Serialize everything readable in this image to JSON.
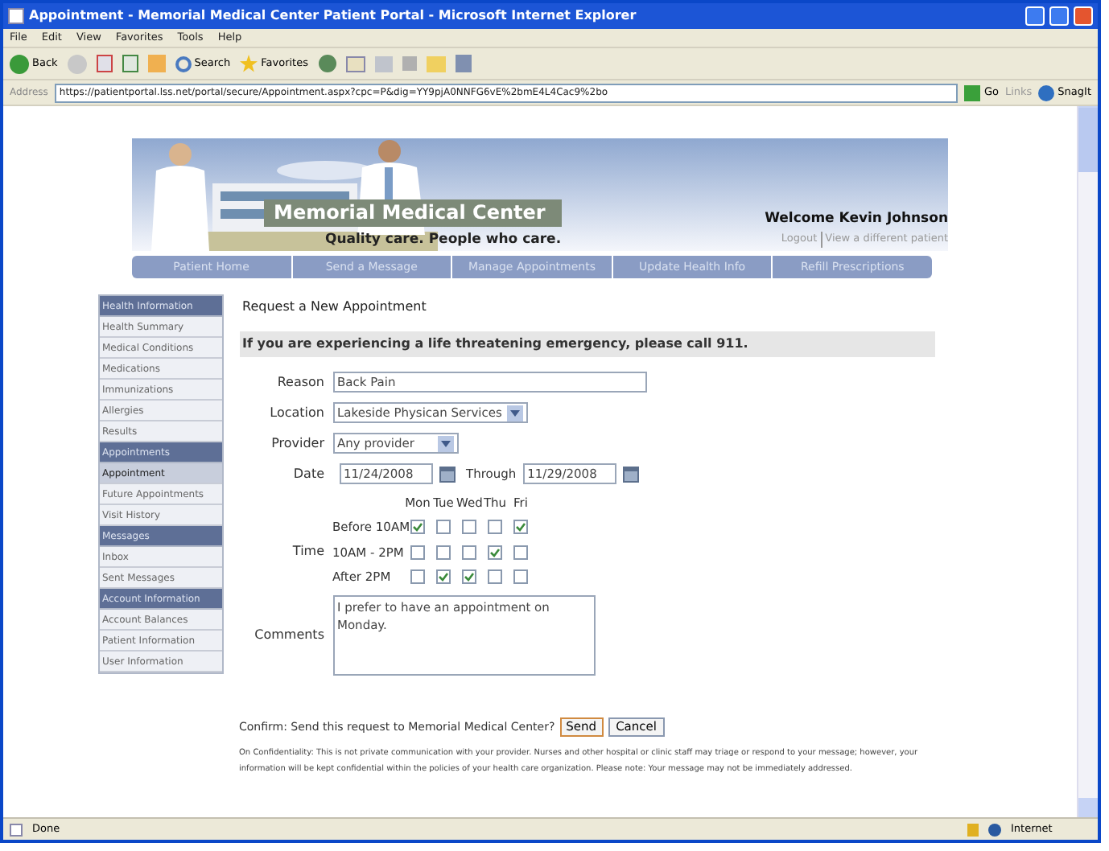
{
  "window": {
    "title": "Appointment - Memorial Medical Center Patient Portal - Microsoft Internet Explorer"
  },
  "menu": [
    "File",
    "Edit",
    "View",
    "Favorites",
    "Tools",
    "Help"
  ],
  "toolbar": {
    "back": "Back",
    "search": "Search",
    "favorites": "Favorites"
  },
  "address_bar": {
    "label": "Address",
    "url": "https://patientportal.lss.net/portal/secure/Appointment.aspx?cpc=P&dig=YY9pjA0NNFG6vE%2bmE4L4Cac9%2bo",
    "go": "Go",
    "links": "Links",
    "snagit": "SnagIt"
  },
  "banner": {
    "title": "Memorial Medical Center",
    "tagline": "Quality care. People who care.",
    "welcome": "Welcome Kevin Johnson",
    "logout": "Logout",
    "switch_patient": "View a different patient"
  },
  "nav": [
    "Patient Home",
    "Send a Message",
    "Manage Appointments",
    "Update Health Info",
    "Refill Prescriptions"
  ],
  "sidebar": [
    {
      "title": "Health Information",
      "items": [
        {
          "label": "Health Summary",
          "selected": false
        },
        {
          "label": "Medical Conditions",
          "selected": false
        },
        {
          "label": "Medications",
          "selected": false
        },
        {
          "label": "Immunizations",
          "selected": false
        },
        {
          "label": "Allergies",
          "selected": false
        },
        {
          "label": "Results",
          "selected": false
        }
      ]
    },
    {
      "title": "Appointments",
      "items": [
        {
          "label": "Appointment",
          "selected": true
        },
        {
          "label": "Future Appointments",
          "selected": false
        },
        {
          "label": "Visit History",
          "selected": false
        }
      ]
    },
    {
      "title": "Messages",
      "items": [
        {
          "label": "Inbox",
          "selected": false
        },
        {
          "label": "Sent Messages",
          "selected": false
        }
      ]
    },
    {
      "title": "Account Information",
      "items": [
        {
          "label": "Account Balances",
          "selected": false
        },
        {
          "label": "Patient Information",
          "selected": false
        },
        {
          "label": "User Information",
          "selected": false
        }
      ]
    }
  ],
  "form": {
    "heading": "Request a New Appointment",
    "emergency": "If you are experiencing a life threatening emergency, please call 911.",
    "reason": {
      "label": "Reason",
      "value": "Back Pain"
    },
    "location": {
      "label": "Location",
      "value": "Lakeside Physican Services"
    },
    "provider": {
      "label": "Provider",
      "value": "Any provider"
    },
    "date": {
      "label": "Date",
      "value": "11/24/2008",
      "through_label": "Through",
      "through_value": "11/29/2008"
    },
    "time": {
      "label": "Time",
      "days": [
        "Mon",
        "Tue",
        "Wed",
        "Thu",
        "Fri"
      ],
      "slots": [
        {
          "label": "Before 10AM",
          "checked": [
            true,
            false,
            false,
            false,
            true
          ]
        },
        {
          "label": "10AM - 2PM",
          "checked": [
            false,
            false,
            false,
            true,
            false
          ]
        },
        {
          "label": "After 2PM",
          "checked": [
            false,
            true,
            true,
            false,
            false
          ]
        }
      ]
    },
    "comments": {
      "label": "Comments",
      "value": "I prefer to have an appointment on Monday."
    },
    "confirm": "Confirm: Send this request to Memorial Medical Center?",
    "send": "Send",
    "cancel": "Cancel",
    "confidentiality": "On Confidentiality: This is not private communication with your provider. Nurses and other hospital or clinic staff may triage or respond to your message; however, your information will be kept confidential within the policies of your health care organization. Please note: Your message may not be immediately addressed."
  },
  "status_bar": {
    "text": "Done",
    "zone": "Internet"
  }
}
